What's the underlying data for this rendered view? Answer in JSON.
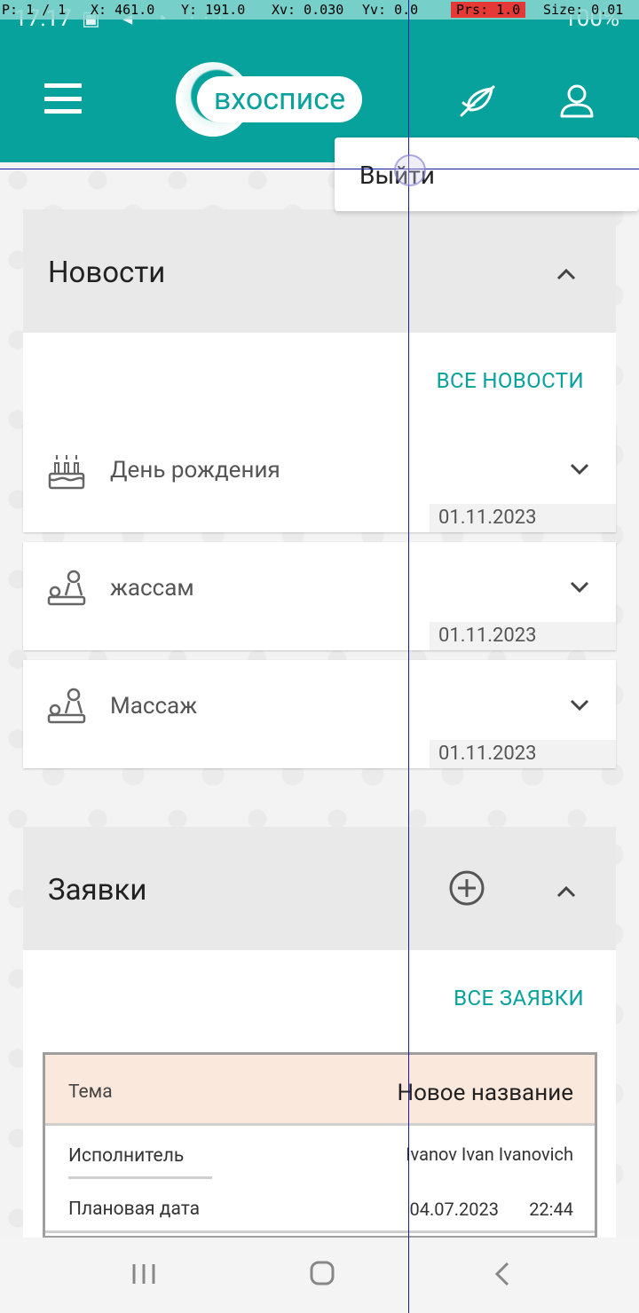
{
  "status_bar": {
    "time": "17:17",
    "icons": "▣ ◂ ◔ ···",
    "battery": "100%"
  },
  "debug_overlay": {
    "p": "P: 1 / 1",
    "x": "X: 461.0",
    "y": "Y: 191.0",
    "xv": "Xv: 0.030",
    "yv": "Yv: 0.0",
    "prs": "Prs: 1.0",
    "size": "Size: 0.01"
  },
  "header": {
    "logo_text": "вхосписе"
  },
  "user_menu": {
    "logout_label": "Выйти"
  },
  "news": {
    "title": "Новости",
    "all_link": "ВСЕ НОВОСТИ",
    "items": [
      {
        "title": "День рождения",
        "date": "01.11.2023",
        "icon": "birthday-cake-icon"
      },
      {
        "title": "жассам",
        "date": "01.11.2023",
        "icon": "massage-icon"
      },
      {
        "title": "Массаж",
        "date": "01.11.2023",
        "icon": "massage-icon"
      }
    ]
  },
  "requests": {
    "title": "Заявки",
    "all_link": "ВСЕ ЗАЯВКИ",
    "card": {
      "topic_label": "Тема",
      "topic_value": "Новое название",
      "executor_label": "Исполнитель",
      "executor_value": "Ivanov Ivan Ivanovich",
      "planned_label": "Плановая дата",
      "planned_date": "04.07.2023",
      "planned_time": "22:44"
    }
  },
  "colors": {
    "brand": "#06a29b",
    "header_bg": "#06a29b",
    "panel_head_bg": "#e9e9e9",
    "request_head_bg": "#fbe8dd"
  }
}
